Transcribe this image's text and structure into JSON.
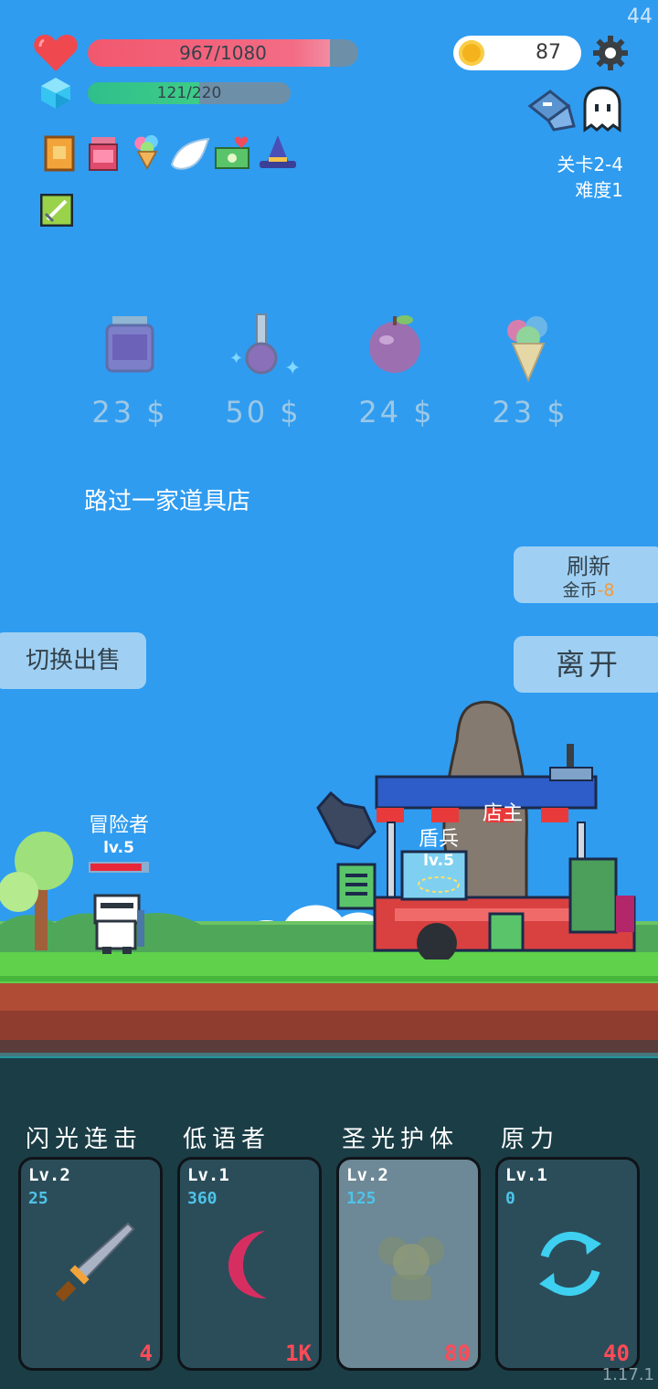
{
  "fps": "44",
  "player": {
    "hp_text": "967/1080",
    "hp_fraction": 0.8954,
    "mp_text": "121/220",
    "mp_fraction": 0.55
  },
  "coins": "87",
  "stage": {
    "level": "关卡2-4",
    "difficulty": "难度1"
  },
  "relics": [
    "spellbook-icon",
    "jam-jar-icon",
    "ice-cream-icon",
    "wing-icon",
    "money-heart-icon",
    "wizard-hat-icon",
    "sword-scroll-icon"
  ],
  "shop": {
    "items": [
      {
        "icon": "jam-jar-icon",
        "price": "23 $"
      },
      {
        "icon": "potion-icon",
        "price": "50 $"
      },
      {
        "icon": "plum-icon",
        "price": "24 $"
      },
      {
        "icon": "ice-cream-icon",
        "price": "23 $"
      }
    ],
    "event_text": "路过一家道具店",
    "refresh_label": "刷新",
    "refresh_cost_label": "金币",
    "refresh_cost": "-8",
    "leave_label": "离开",
    "switch_label": "切换出售"
  },
  "scene": {
    "hero_name": "冒险者",
    "hero_level": "lv.5",
    "hero_hp_fraction": 0.9,
    "shopkeeper_name": "店主",
    "npc_name": "盾兵",
    "npc_level": "lv.5"
  },
  "skills": [
    {
      "name": "闪光连击",
      "level": "Lv.2",
      "cost": "25",
      "price": "4",
      "icon": "sword-icon",
      "dim": false
    },
    {
      "name": "低语者",
      "level": "Lv.1",
      "cost": "360",
      "price": "1K",
      "icon": "crescent-moon-icon",
      "dim": false
    },
    {
      "name": "圣光护体",
      "level": "Lv.2",
      "cost": "125",
      "price": "80",
      "icon": "holy-shield-icon",
      "dim": true
    },
    {
      "name": "原力",
      "level": "Lv.1",
      "cost": "0",
      "price": "40",
      "icon": "cycle-icon",
      "dim": false
    }
  ],
  "version": "1.17.1",
  "colors": {
    "sky": "#2f9cf0",
    "hp": "#f1586e",
    "mp": "#2fbf8a",
    "panel": "#1b3d46",
    "price": "#ff4a58",
    "cost": "#4fc3e8"
  }
}
